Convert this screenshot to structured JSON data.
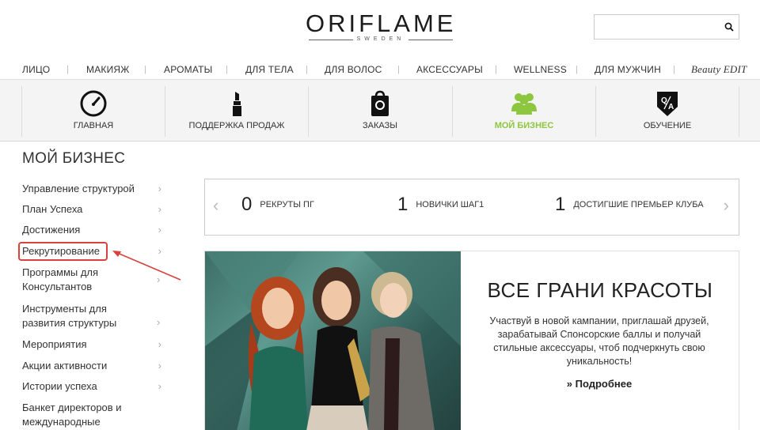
{
  "header": {
    "logo_main": "ORIFLAME",
    "logo_sub": "SWEDEN",
    "search": {
      "placeholder": ""
    }
  },
  "topnav": [
    "ЛИЦО",
    "МАКИЯЖ",
    "АРОМАТЫ",
    "ДЛЯ ТЕЛА",
    "ДЛЯ ВОЛОС",
    "АКСЕССУАРЫ",
    "WELLNESS",
    "ДЛЯ МУЖЧИН",
    "Beauty EDIT"
  ],
  "iconnav": [
    {
      "label": "ГЛАВНАЯ",
      "icon": "speedometer-icon"
    },
    {
      "label": "ПОДДЕРЖКА ПРОДАЖ",
      "icon": "lipstick-icon"
    },
    {
      "label": "ЗАКАЗЫ",
      "icon": "shopping-bag-icon"
    },
    {
      "label": "МОЙ БИЗНЕС",
      "icon": "people-icon",
      "active": true
    },
    {
      "label": "ОБУЧЕНИЕ",
      "icon": "qa-badge-icon"
    }
  ],
  "page_title": "МОЙ БИЗНЕС",
  "sidebar": [
    "Управление структурой",
    "План Успеха",
    "Достижения",
    "Рекрутирование",
    "Программы для Консультантов",
    "Инструменты для развития структуры",
    "Мероприятия",
    "Акции активности",
    "Истории успеха",
    "Банкет директоров и международные"
  ],
  "stats": [
    {
      "value": "0",
      "label": "РЕКРУТЫ ПГ"
    },
    {
      "value": "1",
      "label": "НОВИЧКИ ШАГ1"
    },
    {
      "value": "1",
      "label": "ДОСТИГШИЕ ПРЕМЬЕР КЛУБА"
    }
  ],
  "promo": {
    "title": "ВСЕ ГРАНИ КРАСОТЫ",
    "text": "Участвуй в новой кампании, приглашай друзей, зарабатывай Спонсорские баллы и получай стильные аксессуары, чтоб подчеркнуть свою уникальность!",
    "more": "» Подробнее"
  },
  "colors": {
    "accent": "#8dc63f",
    "highlight": "#d9413c"
  }
}
